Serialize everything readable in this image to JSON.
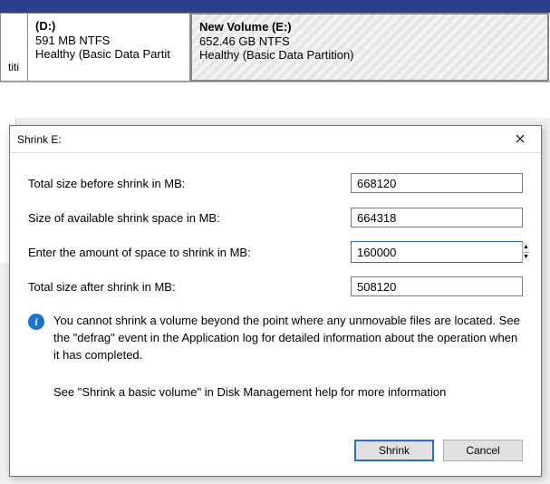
{
  "partitions": {
    "frag_label": "titi",
    "d": {
      "title": "(D:)",
      "size": "591 MB NTFS",
      "status": "Healthy (Basic Data Partit"
    },
    "e": {
      "title": "New Volume  (E:)",
      "size": "652.46 GB NTFS",
      "status": "Healthy (Basic Data Partition)"
    }
  },
  "dialog": {
    "title": "Shrink E:",
    "labels": {
      "total_before": "Total size before shrink in MB:",
      "available": "Size of available shrink space in MB:",
      "enter": "Enter the amount of space to shrink in MB:",
      "total_after": "Total size after shrink in MB:"
    },
    "values": {
      "total_before": "668120",
      "available": "664318",
      "enter": "160000",
      "total_after": "508120"
    },
    "info_line1": "You cannot shrink a volume beyond the point where any unmovable files are located. See the \"defrag\" event in the Application log for detailed information about the operation when it has completed.",
    "info_line2": "See \"Shrink a basic volume\" in Disk Management help for more information",
    "buttons": {
      "shrink": "Shrink",
      "cancel": "Cancel"
    }
  }
}
